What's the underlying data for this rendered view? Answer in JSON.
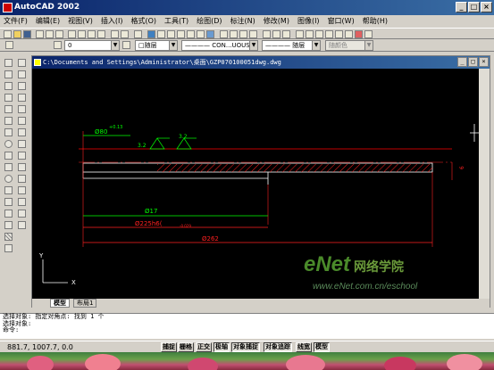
{
  "app": {
    "title": "AutoCAD 2002",
    "window_buttons": [
      "_",
      "□",
      "×"
    ]
  },
  "menu": [
    "文件(F)",
    "编辑(E)",
    "视图(V)",
    "插入(I)",
    "格式(O)",
    "工具(T)",
    "绘图(D)",
    "标注(N)",
    "修改(M)",
    "图像(I)",
    "窗口(W)",
    "帮助(H)"
  ],
  "properties": {
    "layer_value": "0",
    "color_value": "□随层",
    "linetype_value": "———— CON...UOUS",
    "lineweight_value": "———— 随层",
    "plotstyle_value": "随颜色"
  },
  "document": {
    "title": "C:\\Documents and Settings\\Administrator\\桌面\\GZP070100051dwg.dwg",
    "tabs": [
      "模型",
      "布局1"
    ]
  },
  "drawing": {
    "dims": {
      "d1": "Ø80",
      "d1_tol": "+0.13",
      "surf": "3.2",
      "d2": "Ø17",
      "d3": "Ø225h6(",
      "d3_tol": "-0.029",
      "d4": "Ø262",
      "side": "6"
    },
    "ucs": {
      "x": "X",
      "y": "Y"
    }
  },
  "command": {
    "lines": [
      "选择对象: 指定对角点: 找到 1 个",
      "选择对象:",
      "命令:"
    ]
  },
  "status": {
    "coords": "881.7, 1007.7, 0.0",
    "buttons": [
      "捕捉",
      "栅格",
      "正交",
      "极轴",
      "对象捕捉",
      "对象追踪",
      "线宽",
      "模型"
    ]
  },
  "watermark": {
    "logo": "eNet",
    "cn": "网络学院",
    "url": "www.eNet.com.cn/eschool"
  },
  "colors": {
    "title_bar": "#0a246a",
    "canvas_bg": "#000000",
    "dim_red": "#ff0000",
    "dim_green": "#00ff00",
    "geom_white": "#ffffff",
    "toolbar_bg": "#d4d0c8"
  }
}
